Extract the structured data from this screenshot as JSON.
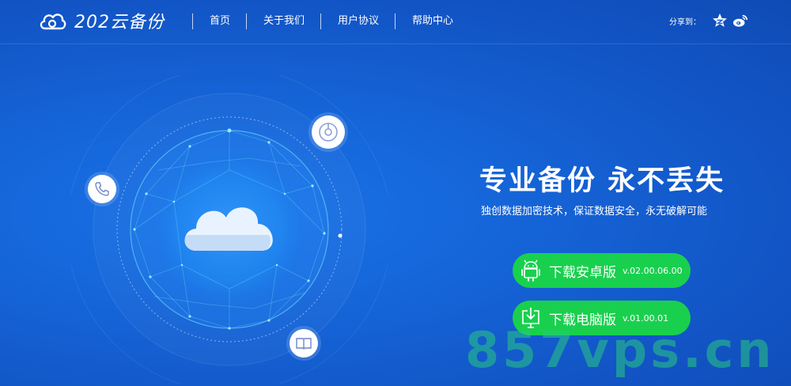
{
  "header": {
    "logo_text": "202云备份",
    "nav": [
      "首页",
      "关于我们",
      "用户协议",
      "帮助中心"
    ],
    "share_label": "分享到："
  },
  "hero": {
    "title": "专业备份 永不丢失",
    "subtitle": "独创数据加密技术，保证数据安全，永无破解可能"
  },
  "downloads": [
    {
      "label": "下载安卓版",
      "version": "v.02.00.06.00",
      "icon": "android-icon"
    },
    {
      "label": "下载电脑版",
      "version": "v.01.00.01",
      "icon": "download-pc-icon"
    }
  ],
  "watermark": "857vps.cn",
  "colors": {
    "background": "#1565d8",
    "button_green": "#19d04e",
    "watermark": "#28c882"
  }
}
